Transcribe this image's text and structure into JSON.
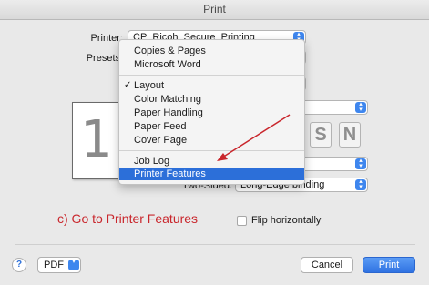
{
  "window": {
    "title": "Print"
  },
  "printer": {
    "label": "Printer:",
    "value": "CP_Ricoh_Secure_Printing"
  },
  "presets": {
    "label": "Presets"
  },
  "menu": {
    "items_top": [
      "Copies & Pages",
      "Microsoft Word"
    ],
    "items_mid": [
      "Layout",
      "Color Matching",
      "Paper Handling",
      "Paper Feed",
      "Cover Page"
    ],
    "checked_item": "Layout",
    "items_bottom": [
      "Job Log",
      "Printer Features"
    ],
    "selected_item": "Printer Features"
  },
  "preview": {
    "page_number": "1"
  },
  "two_sided": {
    "label": "Two-Sided:",
    "value": "Long-Edge binding"
  },
  "flip": {
    "label": "Flip horizontally",
    "checked": false
  },
  "annotation": {
    "text": "c)  Go to Printer Features",
    "color": "#c9262c"
  },
  "footer": {
    "help": "?",
    "pdf": "PDF",
    "cancel": "Cancel",
    "print": "Print"
  },
  "colors": {
    "accent": "#3e86ee",
    "selection": "#2c6fd9"
  }
}
